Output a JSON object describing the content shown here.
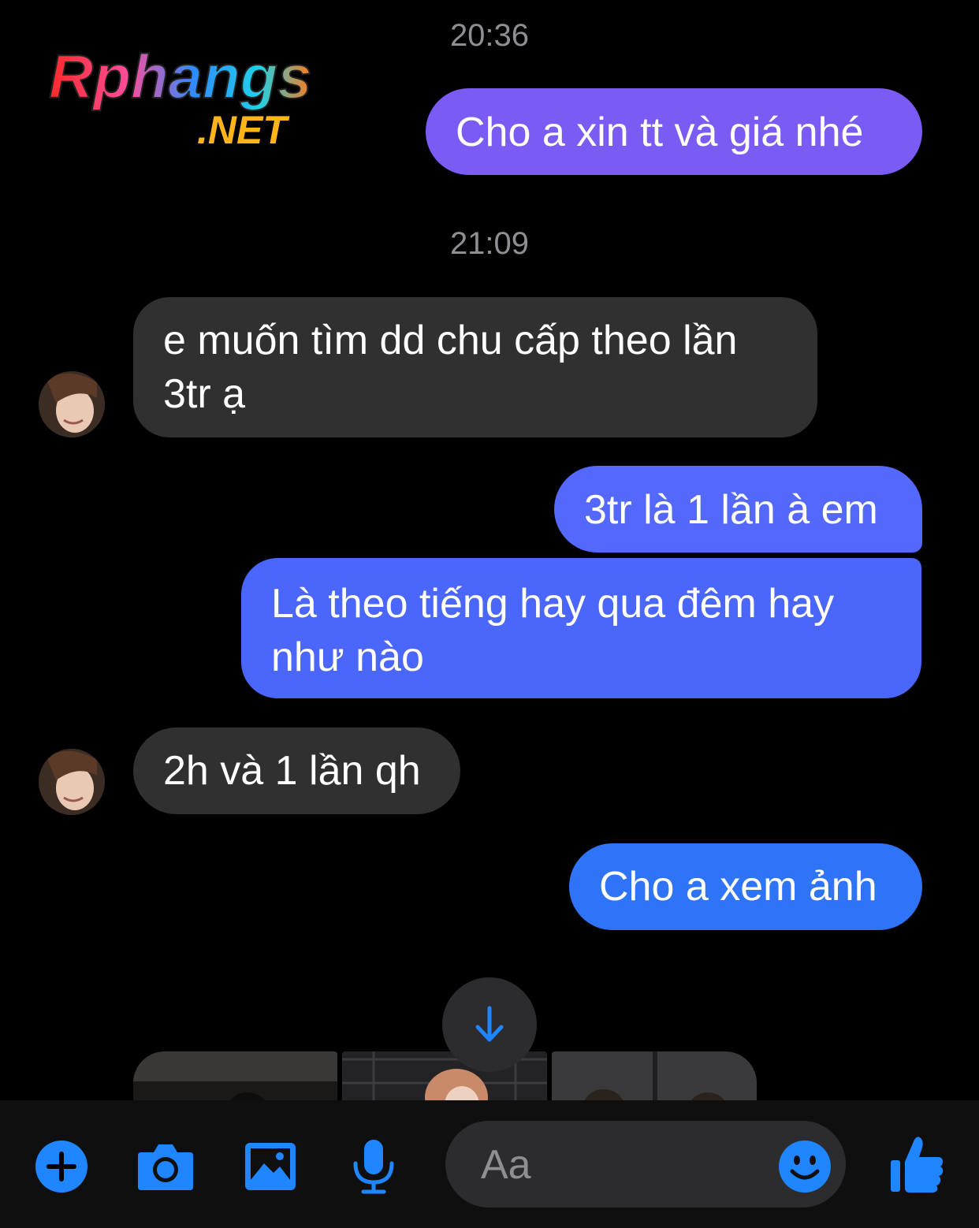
{
  "watermark": {
    "logo_text": "Rphangs",
    "logo_suffix": ".NET"
  },
  "conversation": {
    "timestamps": [
      "20:36",
      "21:09"
    ],
    "messages": [
      {
        "from": "me",
        "lines": [
          "Cho a xin tt và giá nhé"
        ],
        "color": "#7a5cf5"
      },
      {
        "from": "them",
        "lines": [
          "e muốn tìm dd chu cấp theo lần",
          "3tr ạ"
        ],
        "color": "#303030"
      },
      {
        "from": "me",
        "lines": [
          "3tr là 1 lần à em"
        ],
        "color": "#5468fb"
      },
      {
        "from": "me",
        "lines": [
          "Là theo tiếng hay qua đêm hay",
          "như nào"
        ],
        "color": "#4a66fb"
      },
      {
        "from": "them",
        "lines": [
          "2h và 1 lần qh"
        ],
        "color": "#303030"
      },
      {
        "from": "me",
        "lines": [
          "Cho a xem ảnh"
        ],
        "color": "#2f74f7"
      }
    ],
    "photo_count": 3
  },
  "composer": {
    "placeholder": "Aa",
    "icons": [
      "plus-icon",
      "camera-icon",
      "image-icon",
      "microphone-icon",
      "emoji-icon",
      "thumbs-up-icon"
    ],
    "accent": "#1f86ff"
  },
  "scroll_button": {
    "icon": "arrow-down-icon"
  }
}
